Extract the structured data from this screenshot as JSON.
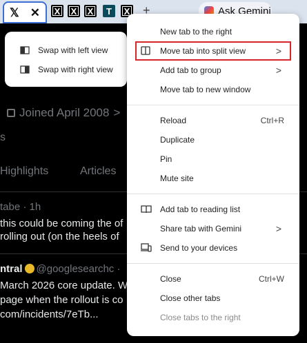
{
  "tabstrip": {
    "active_tab_icon": "x-logo",
    "close_glyph": "✕",
    "pinned_glyphs": [
      "X",
      "X",
      "X",
      "T",
      "X"
    ],
    "new_tab_glyph": "+",
    "ask_gemini_label": "Ask Gemini"
  },
  "page": {
    "joined": "Joined April 2008",
    "joined_chevron": ">",
    "fragment_s": "s",
    "tab_highlights": "Highlights",
    "tab_articles": "Articles",
    "post1_meta": "tabe · 1h",
    "post1_line1": "this could be coming the of",
    "post1_line2": "rolling out (on the heels of",
    "post2_author": "ntral",
    "post2_handle": "@googlesearchc ·",
    "post2_line1": "March 2026 core update. W",
    "post2_line2": "page when the rollout is co",
    "post2_line3": "com/incidents/7eTb..."
  },
  "split_menu": {
    "items": [
      {
        "label": "Swap with left view",
        "icon": "swap-left-icon"
      },
      {
        "label": "Swap with right view",
        "icon": "swap-right-icon"
      }
    ]
  },
  "context_menu": {
    "new_tab_right": "New tab to the right",
    "split_view": "Move tab into split view",
    "add_to_group": "Add tab to group",
    "new_window": "Move tab to new window",
    "reload": "Reload",
    "reload_shortcut": "Ctrl+R",
    "duplicate": "Duplicate",
    "pin": "Pin",
    "mute": "Mute site",
    "reading_list": "Add tab to reading list",
    "share_gemini": "Share tab with Gemini",
    "send_devices": "Send to your devices",
    "close": "Close",
    "close_shortcut": "Ctrl+W",
    "close_others": "Close other tabs",
    "close_right": "Close tabs to the right",
    "submenu_chevron": ">"
  },
  "colors": {
    "highlight_border": "#d7262b",
    "tabstrip_bg": "#dbe3ef",
    "page_bg": "#000000"
  }
}
